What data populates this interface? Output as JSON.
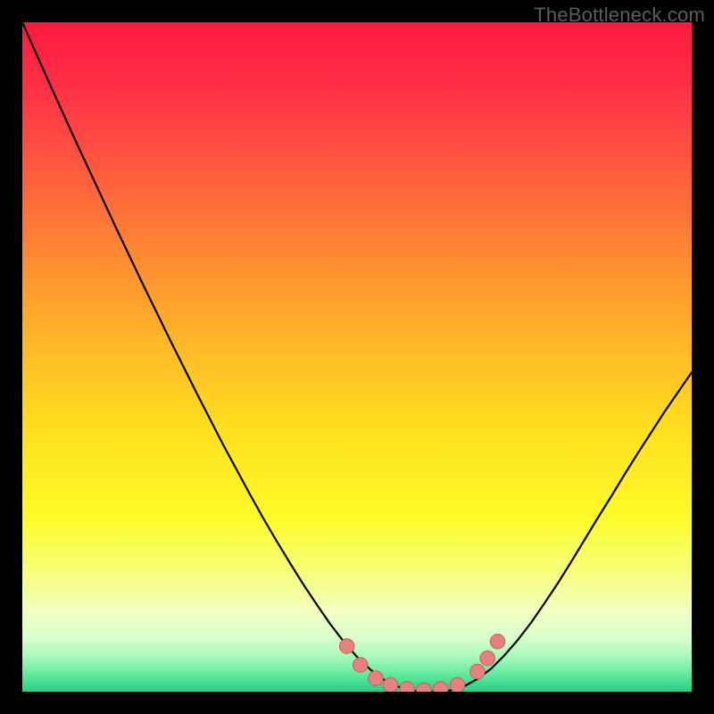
{
  "watermark": "TheBottleneck.com",
  "chart_data": {
    "type": "line",
    "title": "",
    "xlabel": "",
    "ylabel": "",
    "xlim": [
      0,
      100
    ],
    "ylim": [
      0,
      100
    ],
    "background": {
      "type": "vertical-gradient",
      "stops": [
        {
          "offset": 0.0,
          "color": "#ff1a3f"
        },
        {
          "offset": 0.1,
          "color": "#ff3146"
        },
        {
          "offset": 0.22,
          "color": "#ff5a3f"
        },
        {
          "offset": 0.35,
          "color": "#ff8a32"
        },
        {
          "offset": 0.48,
          "color": "#ffb728"
        },
        {
          "offset": 0.62,
          "color": "#ffe31e"
        },
        {
          "offset": 0.74,
          "color": "#fdfb2a"
        },
        {
          "offset": 0.82,
          "color": "#f7ff7a"
        },
        {
          "offset": 0.88,
          "color": "#f3ffc0"
        },
        {
          "offset": 0.92,
          "color": "#d8ffce"
        },
        {
          "offset": 0.95,
          "color": "#a3f7b7"
        },
        {
          "offset": 0.975,
          "color": "#5fe99d"
        },
        {
          "offset": 1.0,
          "color": "#22cf82"
        }
      ]
    },
    "curve": {
      "stroke": "#000000",
      "stroke_width": 2.2,
      "x": [
        0.0,
        2,
        4,
        6,
        8,
        10,
        12,
        14,
        16,
        18,
        20,
        22,
        24,
        26,
        28,
        30,
        32,
        34,
        36,
        38,
        40,
        42,
        44,
        46,
        48,
        50,
        52,
        54,
        56,
        58,
        60,
        62,
        64,
        66,
        68,
        70,
        72,
        74,
        76,
        78,
        80,
        82,
        84,
        86,
        88,
        90,
        92,
        94,
        96,
        98,
        100
      ],
      "y": [
        100.0,
        95.5,
        91.0,
        86.6,
        82.2,
        77.9,
        73.6,
        69.3,
        65.1,
        60.9,
        56.8,
        52.7,
        48.7,
        44.7,
        40.8,
        36.9,
        33.2,
        29.5,
        25.9,
        22.5,
        19.2,
        16.0,
        13.0,
        10.1,
        7.5,
        5.2,
        3.3,
        1.8,
        0.8,
        0.2,
        0.0,
        0.0,
        0.2,
        0.8,
        1.9,
        3.4,
        5.4,
        7.7,
        10.3,
        13.2,
        16.2,
        19.4,
        22.7,
        26.0,
        29.2,
        32.5,
        35.7,
        38.8,
        41.9,
        44.8,
        47.7
      ]
    },
    "markers": {
      "color": "#e98080",
      "stroke": "#c65c5c",
      "radius_pct": 1.1,
      "points": [
        {
          "x": 48.5,
          "y": 6.8
        },
        {
          "x": 50.5,
          "y": 4.0
        },
        {
          "x": 52.8,
          "y": 2.0
        },
        {
          "x": 55.0,
          "y": 1.0
        },
        {
          "x": 57.5,
          "y": 0.4
        },
        {
          "x": 60.0,
          "y": 0.2
        },
        {
          "x": 62.5,
          "y": 0.4
        },
        {
          "x": 65.0,
          "y": 1.0
        },
        {
          "x": 68.0,
          "y": 3.0
        },
        {
          "x": 69.5,
          "y": 5.0
        },
        {
          "x": 71.0,
          "y": 7.5
        }
      ]
    }
  }
}
